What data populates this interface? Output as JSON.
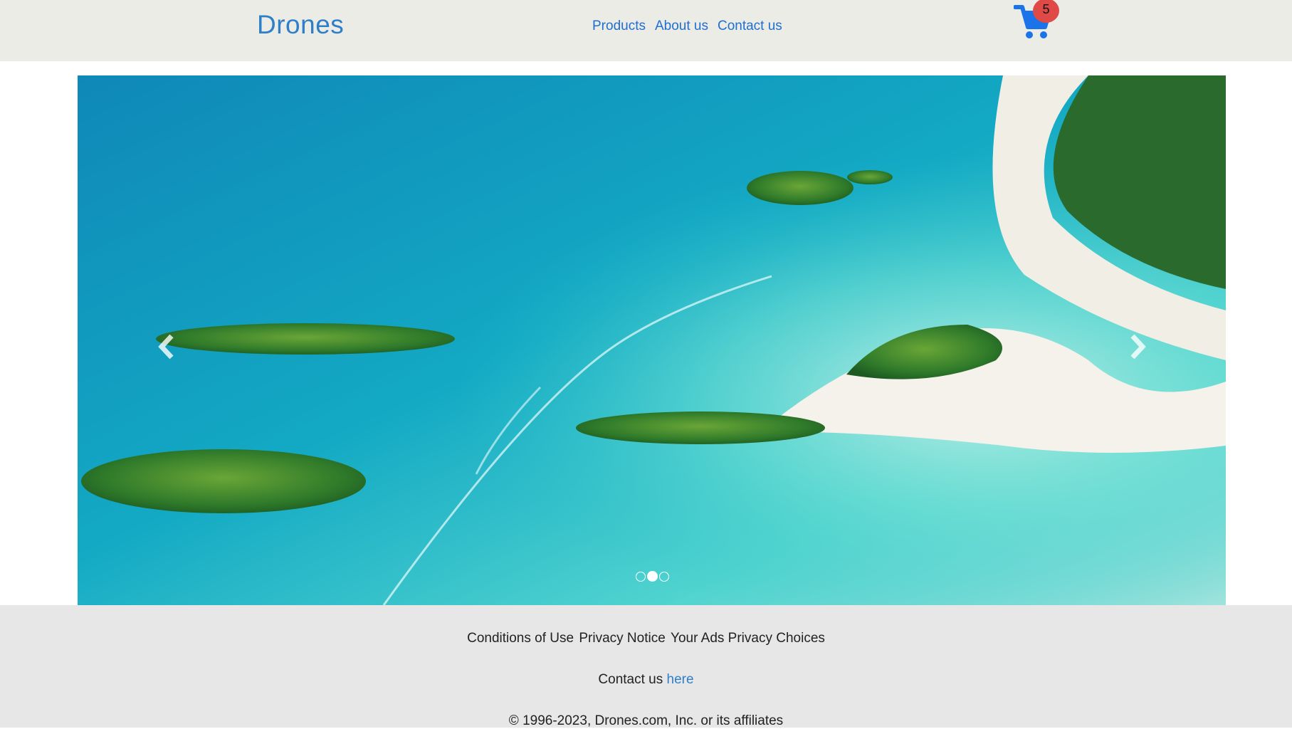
{
  "header": {
    "brand": "Drones",
    "nav": [
      {
        "label": "Products"
      },
      {
        "label": "About us"
      },
      {
        "label": "Contact us"
      }
    ],
    "cart": {
      "count": "5",
      "icon": "cart-icon"
    }
  },
  "carousel": {
    "slide_count": 3,
    "active_index": 1,
    "prev_icon": "chevron-left-icon",
    "next_icon": "chevron-right-icon"
  },
  "footer": {
    "links": [
      "Conditions of Use",
      "Privacy Notice",
      "Your Ads Privacy Choices"
    ],
    "contact_prefix": "Contact us",
    "contact_link": "here",
    "copyright": "© 1996-2023, Drones.com, Inc. or its affiliates"
  },
  "colors": {
    "brand": "#2f7fc8",
    "nav_link": "#1f6fd0",
    "cart": "#1a73e8",
    "badge": "#e04a46",
    "header_bg": "#ecece6",
    "footer_bg": "#e7e7e7"
  }
}
